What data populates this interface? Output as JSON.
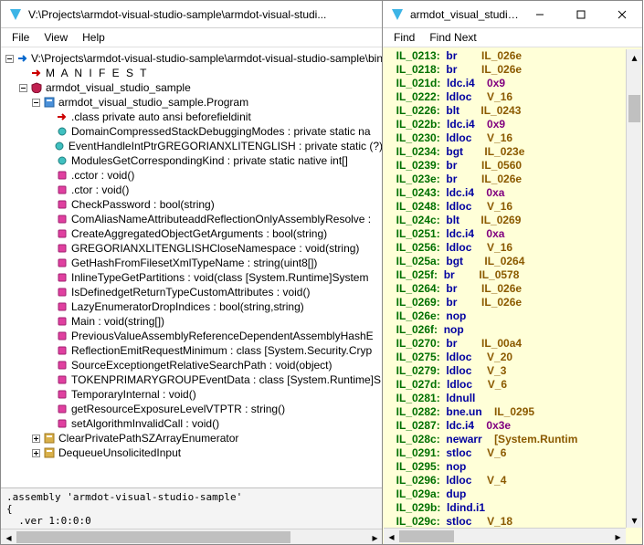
{
  "leftWindow": {
    "title": "V:\\Projects\\armdot-visual-studio-sample\\armdot-visual-studi...",
    "menu": [
      "File",
      "View",
      "Help"
    ],
    "tree": [
      {
        "d": 0,
        "tw": "minus",
        "ic": "arrow-blue",
        "text": "V:\\Projects\\armdot-visual-studio-sample\\armdot-visual-studio-sample\\bin"
      },
      {
        "d": 1,
        "tw": "none",
        "ic": "arrow-red",
        "text": "M A N I F E S T",
        "spaced": true
      },
      {
        "d": 1,
        "tw": "minus",
        "ic": "shield",
        "text": "armdot_visual_studio_sample"
      },
      {
        "d": 2,
        "tw": "minus",
        "ic": "class",
        "text": "armdot_visual_studio_sample.Program"
      },
      {
        "d": 3,
        "tw": "none",
        "ic": "arrow-red",
        "text": ".class private auto ansi beforefieldinit"
      },
      {
        "d": 3,
        "tw": "none",
        "ic": "field",
        "text": "DomainCompressedStackDebuggingModes : private static na"
      },
      {
        "d": 3,
        "tw": "none",
        "ic": "field",
        "text": "EventHandleIntPtrGREGORIANXLITENGLISH : private static (?)"
      },
      {
        "d": 3,
        "tw": "none",
        "ic": "field",
        "text": "ModulesGetCorrespondingKind : private static native int[]"
      },
      {
        "d": 3,
        "tw": "none",
        "ic": "method",
        "text": ".cctor : void()"
      },
      {
        "d": 3,
        "tw": "none",
        "ic": "method",
        "text": ".ctor : void()"
      },
      {
        "d": 3,
        "tw": "none",
        "ic": "method",
        "text": "CheckPassword : bool(string)"
      },
      {
        "d": 3,
        "tw": "none",
        "ic": "method",
        "text": "ComAliasNameAttributeaddReflectionOnlyAssemblyResolve :"
      },
      {
        "d": 3,
        "tw": "none",
        "ic": "method",
        "text": "CreateAggregatedObjectGetArguments : bool(string)"
      },
      {
        "d": 3,
        "tw": "none",
        "ic": "method",
        "text": "GREGORIANXLITENGLISHCloseNamespace : void(string)"
      },
      {
        "d": 3,
        "tw": "none",
        "ic": "method",
        "text": "GetHashFromFilesetXmlTypeName : string(uint8[])"
      },
      {
        "d": 3,
        "tw": "none",
        "ic": "method",
        "text": "InlineTypeGetPartitions : void(class [System.Runtime]System"
      },
      {
        "d": 3,
        "tw": "none",
        "ic": "method",
        "text": "IsDefinedgetReturnTypeCustomAttributes : void()"
      },
      {
        "d": 3,
        "tw": "none",
        "ic": "method",
        "text": "LazyEnumeratorDropIndices : bool(string,string)"
      },
      {
        "d": 3,
        "tw": "none",
        "ic": "method",
        "text": "Main : void(string[])"
      },
      {
        "d": 3,
        "tw": "none",
        "ic": "method",
        "text": "PreviousValueAssemblyReferenceDependentAssemblyHashE"
      },
      {
        "d": 3,
        "tw": "none",
        "ic": "method",
        "text": "ReflectionEmitRequestMinimum : class [System.Security.Cryp"
      },
      {
        "d": 3,
        "tw": "none",
        "ic": "method",
        "text": "SourceExceptiongetRelativeSearchPath : void(object)"
      },
      {
        "d": 3,
        "tw": "none",
        "ic": "method",
        "text": "TOKENPRIMARYGROUPEventData : class [System.Runtime]S"
      },
      {
        "d": 3,
        "tw": "none",
        "ic": "method",
        "text": "TemporaryInternal : void()"
      },
      {
        "d": 3,
        "tw": "none",
        "ic": "method",
        "text": "getResourceExposureLevelVTPTR : string()"
      },
      {
        "d": 3,
        "tw": "none",
        "ic": "method",
        "text": "setAlgorithmInvalidCall : void()"
      },
      {
        "d": 2,
        "tw": "plus",
        "ic": "class-gold",
        "text": "ClearPrivatePathSZArrayEnumerator"
      },
      {
        "d": 2,
        "tw": "plus",
        "ic": "class-gold",
        "text": "DequeueUnsolicitedInput"
      }
    ],
    "bottom": ".assembly 'armdot-visual-studio-sample'\n{\n  .ver 1:0:0:0"
  },
  "rightWindow": {
    "title": "armdot_visual_studio_s...",
    "menu": [
      "Find",
      "Find Next"
    ],
    "il": [
      [
        "IL_0213:",
        "br",
        "IL_026e"
      ],
      [
        "IL_0218:",
        "br",
        "IL_026e"
      ],
      [
        "IL_021d:",
        "ldc.i4",
        "0x9"
      ],
      [
        "IL_0222:",
        "ldloc",
        "V_16"
      ],
      [
        "IL_0226:",
        "blt",
        "IL_0243"
      ],
      [
        "IL_022b:",
        "ldc.i4",
        "0x9"
      ],
      [
        "IL_0230:",
        "ldloc",
        "V_16"
      ],
      [
        "IL_0234:",
        "bgt",
        "IL_023e"
      ],
      [
        "IL_0239:",
        "br",
        "IL_0560"
      ],
      [
        "IL_023e:",
        "br",
        "IL_026e"
      ],
      [
        "IL_0243:",
        "ldc.i4",
        "0xa"
      ],
      [
        "IL_0248:",
        "ldloc",
        "V_16"
      ],
      [
        "IL_024c:",
        "blt",
        "IL_0269"
      ],
      [
        "IL_0251:",
        "ldc.i4",
        "0xa"
      ],
      [
        "IL_0256:",
        "ldloc",
        "V_16"
      ],
      [
        "IL_025a:",
        "bgt",
        "IL_0264"
      ],
      [
        "IL_025f:",
        "br",
        "IL_0578"
      ],
      [
        "IL_0264:",
        "br",
        "IL_026e"
      ],
      [
        "IL_0269:",
        "br",
        "IL_026e"
      ],
      [
        "IL_026e:",
        "nop",
        ""
      ],
      [
        "IL_026f:",
        "nop",
        ""
      ],
      [
        "IL_0270:",
        "br",
        "IL_00a4"
      ],
      [
        "IL_0275:",
        "ldloc",
        "V_20"
      ],
      [
        "IL_0279:",
        "ldloc",
        "V_3"
      ],
      [
        "IL_027d:",
        "ldloc",
        "V_6"
      ],
      [
        "IL_0281:",
        "ldnull",
        ""
      ],
      [
        "IL_0282:",
        "bne.un",
        "IL_0295"
      ],
      [
        "IL_0287:",
        "ldc.i4",
        "0x3e"
      ],
      [
        "IL_028c:",
        "newarr",
        "[System.Runtim"
      ],
      [
        "IL_0291:",
        "stloc",
        "V_6"
      ],
      [
        "IL_0295:",
        "nop",
        ""
      ],
      [
        "IL_0296:",
        "ldloc",
        "V_4"
      ],
      [
        "IL_029a:",
        "dup",
        ""
      ],
      [
        "IL_029b:",
        "ldind.i1",
        ""
      ],
      [
        "IL_029c:",
        "stloc",
        "V_18"
      ]
    ]
  }
}
